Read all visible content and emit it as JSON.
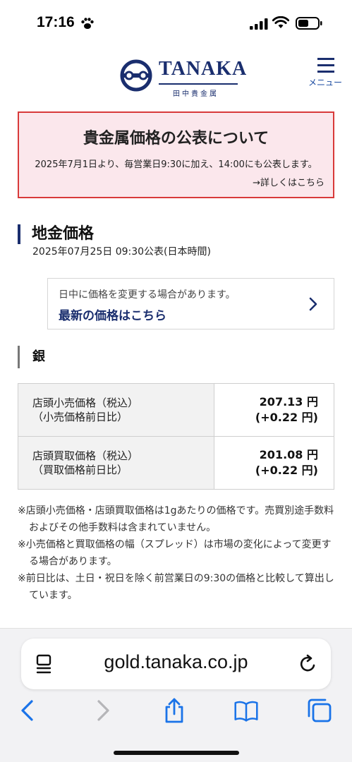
{
  "status_bar": {
    "time": "17:16"
  },
  "header": {
    "logo_text": "TANAKA",
    "logo_sub": "田中貴金属",
    "menu_label": "メニュー"
  },
  "notice": {
    "title": "貴金属価格の公表について",
    "body": "2025年7月1日より、毎営業日9:30に加え、14:00にも公表します。",
    "link": "→詳しくはこちら"
  },
  "section": {
    "title": "地金価格",
    "date": "2025年07月25日 09:30公表(日本時間)"
  },
  "update_box": {
    "note": "日中に価格を変更する場合があります。",
    "link": "最新の価格はこちら"
  },
  "metal": {
    "title": "銀",
    "rows": [
      {
        "label_line1": "店頭小売価格（税込）",
        "label_line2": "（小売価格前日比）",
        "price": "207.13 円",
        "change": "(+0.22 円)"
      },
      {
        "label_line1": "店頭買取価格（税込）",
        "label_line2": "（買取価格前日比）",
        "price": "201.08 円",
        "change": "(+0.22 円)"
      }
    ]
  },
  "notes": [
    "※店頭小売価格・店頭買取価格は1gあたりの価格です。売買別途手数料およびその他手数料は含まれていません。",
    "※小売価格と買取価格の幅（スプレッド）は市場の変化によって変更する場合があります。",
    "※前日比は、土日・祝日を除く前営業日の9:30の価格と比較して算出しています。"
  ],
  "browser": {
    "url": "gold.tanaka.co.jp",
    "accent": "#1a73e8"
  }
}
